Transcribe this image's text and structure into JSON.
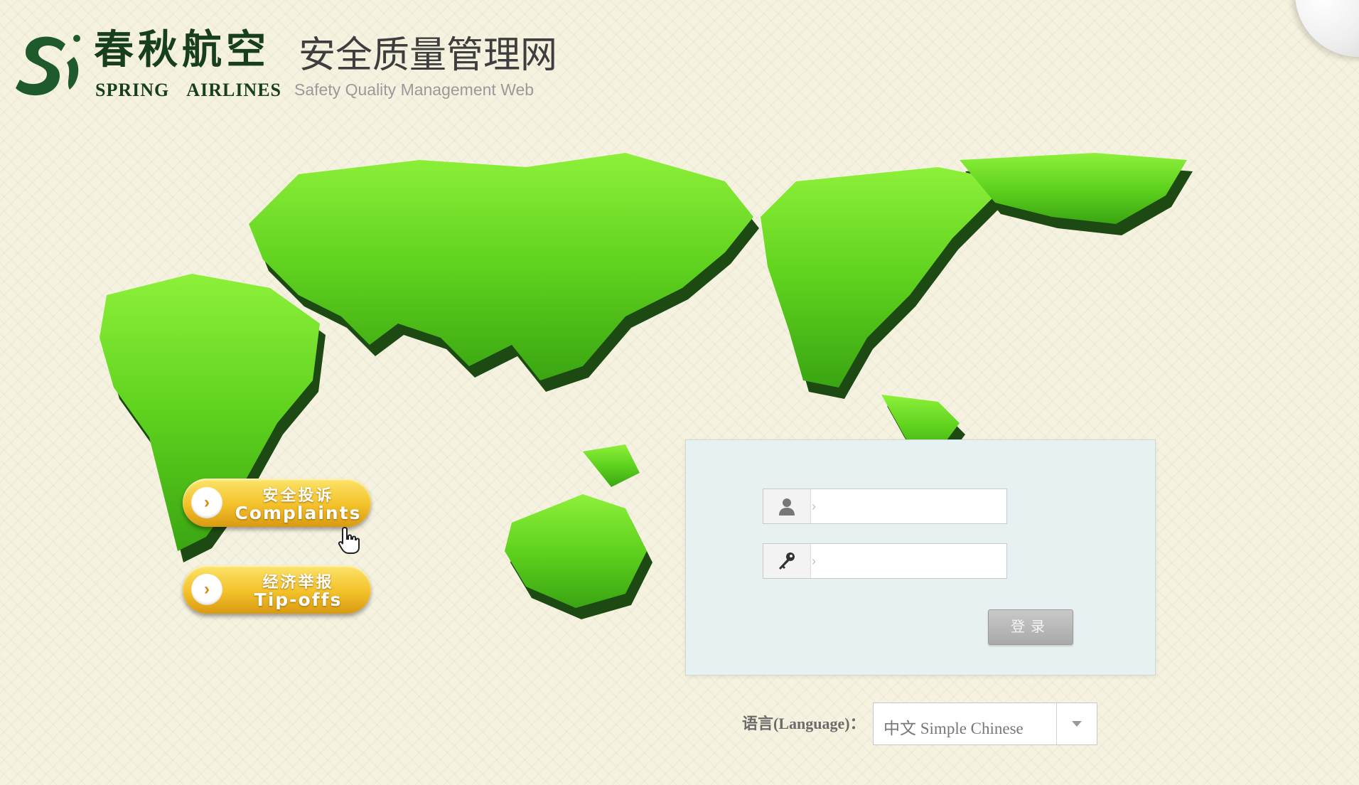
{
  "header": {
    "brand_cn": "春秋航空",
    "brand_en": "SPRING AIRLINES",
    "site_title_cn": "安全质量管理网",
    "site_title_en": "Safety Quality Management Web"
  },
  "side_buttons": {
    "complaints": {
      "cn": "安全投诉",
      "en": "Complaints"
    },
    "tipoffs": {
      "cn": "经济举报",
      "en": "Tip-offs"
    }
  },
  "login": {
    "username_value": "",
    "password_value": "",
    "submit_label": "登录"
  },
  "language": {
    "label": "语言(Language)：",
    "selected": "中文 Simple Chinese"
  },
  "colors": {
    "brand_green": "#173f1f",
    "map_green": "#5fd21e",
    "button_gold": "#f3c12a",
    "panel_bg": "#e7f1f1"
  },
  "icons": {
    "user": "user-icon",
    "password": "key-icon",
    "arrow": "chevron-right-icon",
    "dropdown": "chevron-down-icon"
  }
}
